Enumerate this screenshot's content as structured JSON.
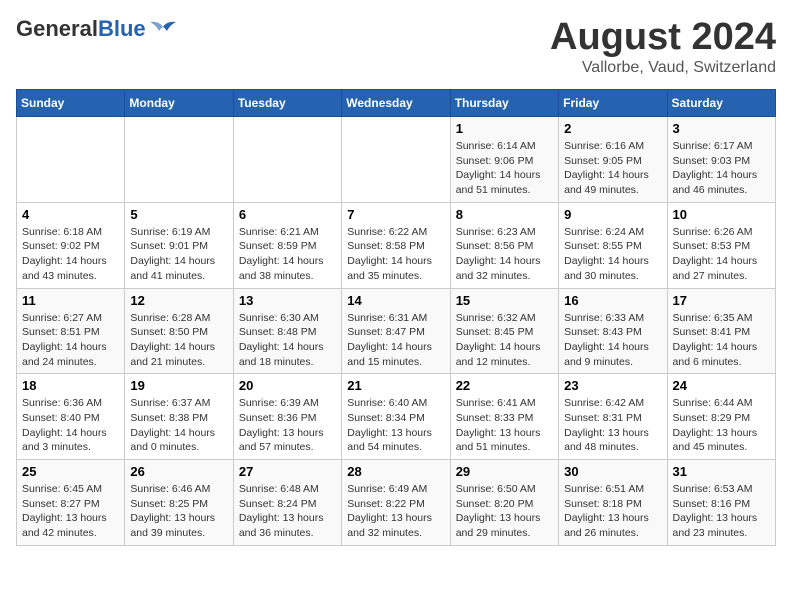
{
  "header": {
    "logo_general": "General",
    "logo_blue": "Blue",
    "month_title": "August 2024",
    "location": "Vallorbe, Vaud, Switzerland"
  },
  "weekdays": [
    "Sunday",
    "Monday",
    "Tuesday",
    "Wednesday",
    "Thursday",
    "Friday",
    "Saturday"
  ],
  "weeks": [
    [
      {
        "day": "",
        "info": ""
      },
      {
        "day": "",
        "info": ""
      },
      {
        "day": "",
        "info": ""
      },
      {
        "day": "",
        "info": ""
      },
      {
        "day": "1",
        "info": "Sunrise: 6:14 AM\nSunset: 9:06 PM\nDaylight: 14 hours\nand 51 minutes."
      },
      {
        "day": "2",
        "info": "Sunrise: 6:16 AM\nSunset: 9:05 PM\nDaylight: 14 hours\nand 49 minutes."
      },
      {
        "day": "3",
        "info": "Sunrise: 6:17 AM\nSunset: 9:03 PM\nDaylight: 14 hours\nand 46 minutes."
      }
    ],
    [
      {
        "day": "4",
        "info": "Sunrise: 6:18 AM\nSunset: 9:02 PM\nDaylight: 14 hours\nand 43 minutes."
      },
      {
        "day": "5",
        "info": "Sunrise: 6:19 AM\nSunset: 9:01 PM\nDaylight: 14 hours\nand 41 minutes."
      },
      {
        "day": "6",
        "info": "Sunrise: 6:21 AM\nSunset: 8:59 PM\nDaylight: 14 hours\nand 38 minutes."
      },
      {
        "day": "7",
        "info": "Sunrise: 6:22 AM\nSunset: 8:58 PM\nDaylight: 14 hours\nand 35 minutes."
      },
      {
        "day": "8",
        "info": "Sunrise: 6:23 AM\nSunset: 8:56 PM\nDaylight: 14 hours\nand 32 minutes."
      },
      {
        "day": "9",
        "info": "Sunrise: 6:24 AM\nSunset: 8:55 PM\nDaylight: 14 hours\nand 30 minutes."
      },
      {
        "day": "10",
        "info": "Sunrise: 6:26 AM\nSunset: 8:53 PM\nDaylight: 14 hours\nand 27 minutes."
      }
    ],
    [
      {
        "day": "11",
        "info": "Sunrise: 6:27 AM\nSunset: 8:51 PM\nDaylight: 14 hours\nand 24 minutes."
      },
      {
        "day": "12",
        "info": "Sunrise: 6:28 AM\nSunset: 8:50 PM\nDaylight: 14 hours\nand 21 minutes."
      },
      {
        "day": "13",
        "info": "Sunrise: 6:30 AM\nSunset: 8:48 PM\nDaylight: 14 hours\nand 18 minutes."
      },
      {
        "day": "14",
        "info": "Sunrise: 6:31 AM\nSunset: 8:47 PM\nDaylight: 14 hours\nand 15 minutes."
      },
      {
        "day": "15",
        "info": "Sunrise: 6:32 AM\nSunset: 8:45 PM\nDaylight: 14 hours\nand 12 minutes."
      },
      {
        "day": "16",
        "info": "Sunrise: 6:33 AM\nSunset: 8:43 PM\nDaylight: 14 hours\nand 9 minutes."
      },
      {
        "day": "17",
        "info": "Sunrise: 6:35 AM\nSunset: 8:41 PM\nDaylight: 14 hours\nand 6 minutes."
      }
    ],
    [
      {
        "day": "18",
        "info": "Sunrise: 6:36 AM\nSunset: 8:40 PM\nDaylight: 14 hours\nand 3 minutes."
      },
      {
        "day": "19",
        "info": "Sunrise: 6:37 AM\nSunset: 8:38 PM\nDaylight: 14 hours\nand 0 minutes."
      },
      {
        "day": "20",
        "info": "Sunrise: 6:39 AM\nSunset: 8:36 PM\nDaylight: 13 hours\nand 57 minutes."
      },
      {
        "day": "21",
        "info": "Sunrise: 6:40 AM\nSunset: 8:34 PM\nDaylight: 13 hours\nand 54 minutes."
      },
      {
        "day": "22",
        "info": "Sunrise: 6:41 AM\nSunset: 8:33 PM\nDaylight: 13 hours\nand 51 minutes."
      },
      {
        "day": "23",
        "info": "Sunrise: 6:42 AM\nSunset: 8:31 PM\nDaylight: 13 hours\nand 48 minutes."
      },
      {
        "day": "24",
        "info": "Sunrise: 6:44 AM\nSunset: 8:29 PM\nDaylight: 13 hours\nand 45 minutes."
      }
    ],
    [
      {
        "day": "25",
        "info": "Sunrise: 6:45 AM\nSunset: 8:27 PM\nDaylight: 13 hours\nand 42 minutes."
      },
      {
        "day": "26",
        "info": "Sunrise: 6:46 AM\nSunset: 8:25 PM\nDaylight: 13 hours\nand 39 minutes."
      },
      {
        "day": "27",
        "info": "Sunrise: 6:48 AM\nSunset: 8:24 PM\nDaylight: 13 hours\nand 36 minutes."
      },
      {
        "day": "28",
        "info": "Sunrise: 6:49 AM\nSunset: 8:22 PM\nDaylight: 13 hours\nand 32 minutes."
      },
      {
        "day": "29",
        "info": "Sunrise: 6:50 AM\nSunset: 8:20 PM\nDaylight: 13 hours\nand 29 minutes."
      },
      {
        "day": "30",
        "info": "Sunrise: 6:51 AM\nSunset: 8:18 PM\nDaylight: 13 hours\nand 26 minutes."
      },
      {
        "day": "31",
        "info": "Sunrise: 6:53 AM\nSunset: 8:16 PM\nDaylight: 13 hours\nand 23 minutes."
      }
    ]
  ]
}
